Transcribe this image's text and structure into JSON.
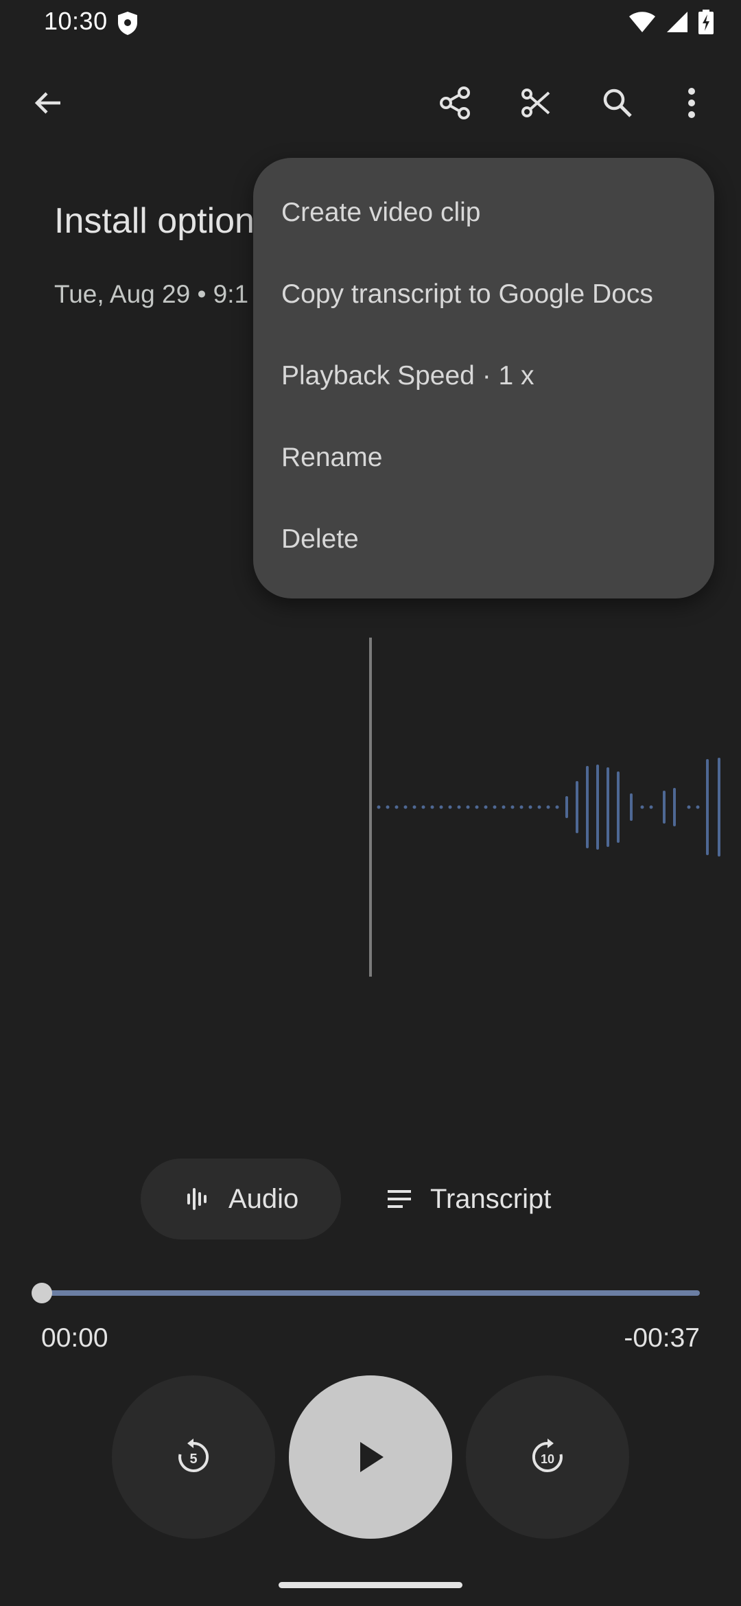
{
  "status_bar": {
    "time": "10:30"
  },
  "recording": {
    "title": "Install option",
    "subtitle": "Tue, Aug 29 • 9:1"
  },
  "overflow_menu": {
    "items": [
      "Create video clip",
      "Copy transcript to Google Docs",
      "Playback Speed · 1 x",
      "Rename",
      "Delete"
    ]
  },
  "tabs": {
    "audio": "Audio",
    "transcript": "Transcript"
  },
  "player": {
    "elapsed": "00:00",
    "remaining": "-00:37",
    "progress": 0,
    "rewind_seconds": "5",
    "forward_seconds": "10"
  },
  "colors": {
    "background": "#1f1f1f",
    "menu": "#444444",
    "accent": "#6b7ea3",
    "waveform": "#4e6894"
  }
}
